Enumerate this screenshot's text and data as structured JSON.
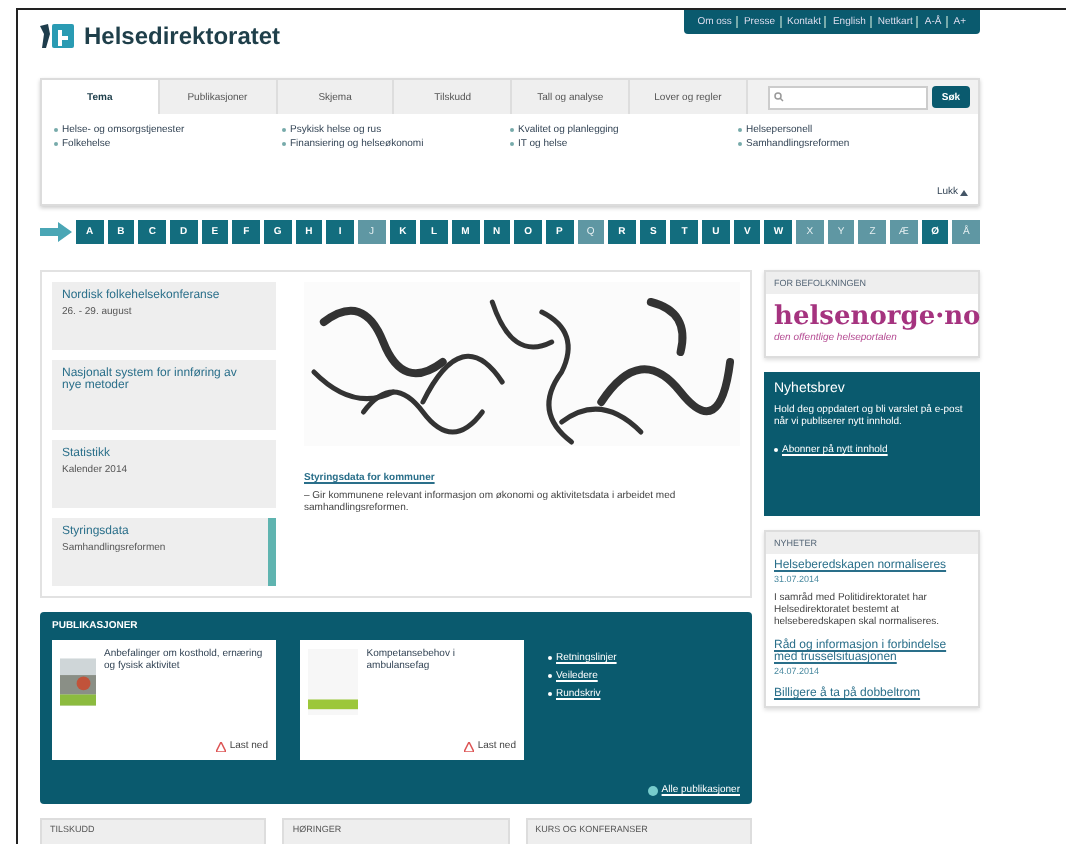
{
  "logo": {
    "text": "Helsedirektoratet"
  },
  "top_links": [
    "Om oss",
    "Presse",
    "Kontakt",
    "English",
    "Nettkart",
    "A-Å",
    "A+"
  ],
  "nav": {
    "tabs": [
      {
        "label": "Tema",
        "selected": true
      },
      {
        "label": "Publikasjoner",
        "selected": false
      },
      {
        "label": "Skjema",
        "selected": false
      },
      {
        "label": "Tilskudd",
        "selected": false
      },
      {
        "label": "Tall og analyse",
        "selected": false
      },
      {
        "label": "Lover og regler",
        "selected": false
      }
    ],
    "search": {
      "button": "Søk"
    },
    "menu_columns": [
      [
        "Helse- og omsorgstjenester",
        "Folkehelse"
      ],
      [
        "Psykisk helse og rus",
        "Finansiering og helseøkonomi"
      ],
      [
        "Kvalitet og planlegging",
        "IT og helse"
      ],
      [
        "Helsepersonell",
        "Samhandlingsreformen"
      ]
    ],
    "close": "Lukk"
  },
  "alphabet": [
    {
      "letter": "A",
      "disabled": false
    },
    {
      "letter": "B",
      "disabled": false
    },
    {
      "letter": "C",
      "disabled": false
    },
    {
      "letter": "D",
      "disabled": false
    },
    {
      "letter": "E",
      "disabled": false
    },
    {
      "letter": "F",
      "disabled": false
    },
    {
      "letter": "G",
      "disabled": false
    },
    {
      "letter": "H",
      "disabled": false
    },
    {
      "letter": "I",
      "disabled": false
    },
    {
      "letter": "J",
      "disabled": true
    },
    {
      "letter": "K",
      "disabled": false
    },
    {
      "letter": "L",
      "disabled": false
    },
    {
      "letter": "M",
      "disabled": false
    },
    {
      "letter": "N",
      "disabled": false
    },
    {
      "letter": "O",
      "disabled": false
    },
    {
      "letter": "P",
      "disabled": false
    },
    {
      "letter": "Q",
      "disabled": true
    },
    {
      "letter": "R",
      "disabled": false
    },
    {
      "letter": "S",
      "disabled": false
    },
    {
      "letter": "T",
      "disabled": false
    },
    {
      "letter": "U",
      "disabled": false
    },
    {
      "letter": "V",
      "disabled": false
    },
    {
      "letter": "W",
      "disabled": false
    },
    {
      "letter": "X",
      "disabled": true
    },
    {
      "letter": "Y",
      "disabled": true
    },
    {
      "letter": "Z",
      "disabled": true
    },
    {
      "letter": "Æ",
      "disabled": true
    },
    {
      "letter": "Ø",
      "disabled": false
    },
    {
      "letter": "Å",
      "disabled": true
    }
  ],
  "feature": {
    "items": [
      {
        "title": "Nordisk folkehelsekonferanse",
        "subtitle": "26. - 29. august",
        "selected": false
      },
      {
        "title": "Nasjonalt system for innføring av nye metoder",
        "selected": false
      },
      {
        "title": "Statistikk",
        "subtitle": "Kalender 2014",
        "selected": false
      },
      {
        "title": "Styringsdata",
        "subtitle": "Samhandlingsreformen",
        "selected": true
      }
    ],
    "link": "Styringsdata for kommuner",
    "text": "– Gir kommunene relevant informasjon om økonomi og aktivitetsdata i arbeidet med samhandlingsreformen."
  },
  "publications": {
    "title": "PUBLIKASJONER",
    "items": [
      {
        "title": "Anbefalinger om kosthold, ernæring og fysisk aktivitet",
        "download": "Last ned"
      },
      {
        "title": "Kompetansebehov i ambulansefag",
        "download": "Last ned",
        "kind": "plain"
      }
    ],
    "links": [
      "Retningslinjer",
      "Veiledere",
      "Rundskriv"
    ],
    "all_link": "Alle publikasjoner"
  },
  "bottom_boxes": [
    "TILSKUDD",
    "HØRINGER",
    "KURS OG KONFERANSER"
  ],
  "population": {
    "heading": "FOR BEFOLKNINGEN",
    "brand": "helsenorge·no",
    "tagline": "den offentlige helseportalen"
  },
  "newsletter": {
    "title": "Nyhetsbrev",
    "text": "Hold deg oppdatert og bli varslet på e-post når vi publiserer nytt innhold.",
    "link": "Abonner på nytt innhold"
  },
  "news": {
    "heading": "NYHETER",
    "items": [
      {
        "title": "Helseberedskapen normaliseres",
        "date": "31.07.2014",
        "summary": "I samråd med Politidirektoratet har Helsedirektoratet bestemt at helseberedskapen skal normaliseres."
      },
      {
        "title": "Råd og informasjon i forbindelse med trusselsituasjonen",
        "date": "24.07.2014"
      },
      {
        "title": "Billigere å ta på dobbeltrom"
      }
    ]
  }
}
